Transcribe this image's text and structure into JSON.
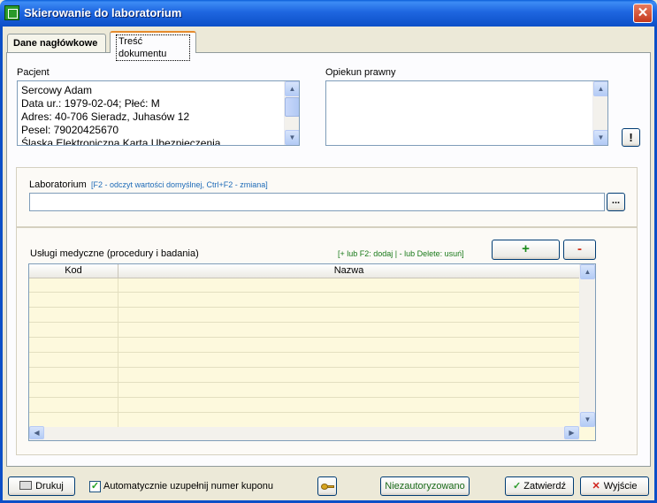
{
  "window": {
    "title": "Skierowanie do laboratorium",
    "close_glyph": "✕"
  },
  "tabs": [
    {
      "label": "Dane nagłówkowe",
      "active": false
    },
    {
      "label": "Treść dokumentu",
      "active": true
    }
  ],
  "patient": {
    "label": "Pacjent",
    "lines": [
      "Sercowy Adam",
      "Data ur.: 1979-02-04; Płeć: M",
      "Adres: 40-706 Sieradz, Juhasów 12",
      "Pesel: 79020425670",
      "Śląska Elektroniczna Karta Ubezpieczenia"
    ]
  },
  "guardian": {
    "label": "Opiekun prawny",
    "value": ""
  },
  "exclamation_button": "!",
  "laboratory": {
    "label": "Laboratorium",
    "hint": "[F2 - odczyt wartości domyślnej, Ctrl+F2 - zmiana]",
    "value": "",
    "browse_button": "..."
  },
  "services": {
    "label": "Usługi medyczne (procedury i badania)",
    "hint": "[+ lub F2: dodaj  | - lub Delete: usuń]",
    "add_button": "+",
    "remove_button": "-",
    "columns": [
      "Kod",
      "Nazwa"
    ],
    "rows": []
  },
  "footer": {
    "print_button": "Drukuj",
    "auto_coupon_label": "Automatycznie uzupełnij numer kuponu",
    "auto_coupon_checked": true,
    "unauthorized_button": "Niezautoryzowano",
    "confirm_button": "Zatwierdź",
    "exit_button": "Wyjście"
  },
  "colors": {
    "title_bar": "#0C4FC7",
    "grid_bg": "#FDF9DD",
    "hint_blue": "#1E6BB8",
    "hint_green": "#1A7A1A"
  }
}
